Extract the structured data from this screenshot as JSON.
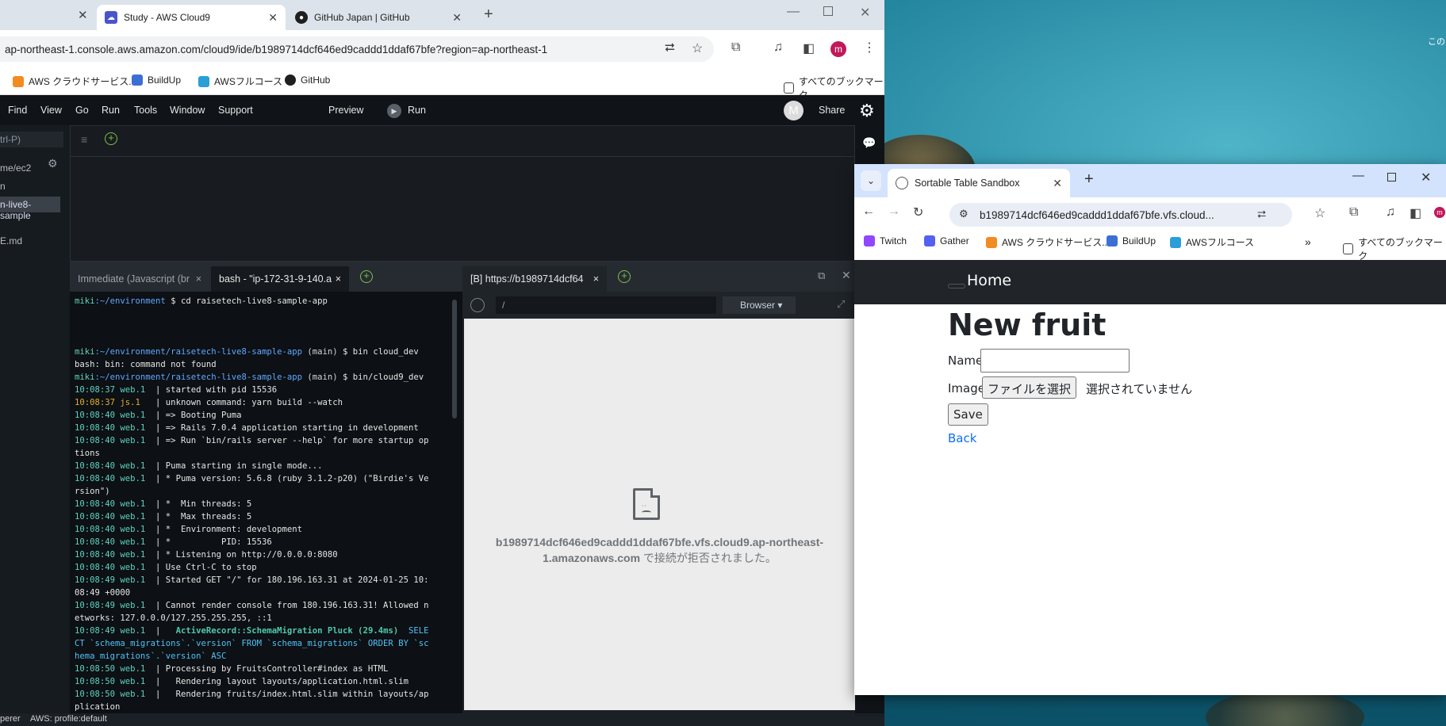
{
  "window1": {
    "tabs": [
      {
        "label": "Study - AWS Cloud9"
      },
      {
        "label": "GitHub Japan | GitHub"
      }
    ],
    "url": "ap-northeast-1.console.aws.amazon.com/cloud9/ide/b1989714dcf646ed9caddd1ddaf67bfe?region=ap-northeast-1",
    "bookmarks": [
      {
        "label": "AWS クラウドサービス..."
      },
      {
        "label": "BuildUp"
      },
      {
        "label": "AWSフルコース"
      },
      {
        "label": "GitHub"
      }
    ],
    "all_bookmarks": "すべてのブックマーク",
    "profile_letter": "m"
  },
  "cloud9": {
    "menu": [
      "Find",
      "View",
      "Go",
      "Run",
      "Tools",
      "Window",
      "Support"
    ],
    "preview": "Preview",
    "run": "Run",
    "avatar": "M",
    "share": "Share",
    "sidebar": {
      "goto": "trl-P)",
      "items": [
        "me/ec2",
        "n",
        "n-live8-sample",
        "E.md"
      ]
    },
    "terminal_tabs": [
      {
        "label": "Immediate (Javascript (br"
      },
      {
        "label": "bash - \"ip-172-31-9-140.a"
      }
    ],
    "terminal_lines": [
      {
        "prefix": "miki",
        "path": ":~/environment",
        "branch": "",
        "cmd": " $ cd raisetech-live8-sample-app"
      },
      {
        "blank": ""
      },
      {
        "blank": ""
      },
      {
        "blank": ""
      },
      {
        "prefix": "miki",
        "path": ":~/environment/raisetech-live8-sample-app",
        "branch": " (main)",
        "cmd": " $ bin cloud_dev"
      },
      {
        "plain": "bash: bin: command not found"
      },
      {
        "prefix": "miki",
        "path": ":~/environment/raisetech-live8-sample-app",
        "branch": " (main)",
        "cmd": " $ bin/cloud9_dev"
      },
      {
        "time": "10:08:37 web.1",
        "text": "  | started with pid 15536"
      },
      {
        "time_y": "10:08:37 js.1 ",
        "text": "  | unknown command: yarn build --watch"
      },
      {
        "time": "10:08:40 web.1",
        "text": "  | => Booting Puma"
      },
      {
        "time": "10:08:40 web.1",
        "text": "  | => Rails 7.0.4 application starting in development"
      },
      {
        "time": "10:08:40 web.1",
        "text": "  | => Run `bin/rails server --help` for more startup op"
      },
      {
        "plain": "tions"
      },
      {
        "time": "10:08:40 web.1",
        "text": "  | Puma starting in single mode..."
      },
      {
        "time": "10:08:40 web.1",
        "text": "  | * Puma version: 5.6.8 (ruby 3.1.2-p20) (\"Birdie's Ve"
      },
      {
        "plain": "rsion\")"
      },
      {
        "time": "10:08:40 web.1",
        "text": "  | *  Min threads: 5"
      },
      {
        "time": "10:08:40 web.1",
        "text": "  | *  Max threads: 5"
      },
      {
        "time": "10:08:40 web.1",
        "text": "  | *  Environment: development"
      },
      {
        "time": "10:08:40 web.1",
        "text": "  | *          PID: 15536"
      },
      {
        "time": "10:08:40 web.1",
        "text": "  | * Listening on http://0.0.0.0:8080"
      },
      {
        "time": "10:08:40 web.1",
        "text": "  | Use Ctrl-C to stop"
      },
      {
        "time": "10:08:49 web.1",
        "text": "  | Started GET \"/\" for 180.196.163.31 at 2024-01-25 10:"
      },
      {
        "plain": "08:49 +0000"
      },
      {
        "time": "10:08:49 web.1",
        "text": "  | Cannot render console from 180.196.163.31! Allowed n"
      },
      {
        "plain": "etworks: 127.0.0.0/127.255.255.255, ::1"
      },
      {
        "time": "10:08:49 web.1",
        "text": "  |   ",
        "hl": "ActiveRecord::SchemaMigration Pluck (29.4ms)",
        "sql": "  SELE"
      },
      {
        "sql_line": "CT `schema_migrations`.`version` FROM `schema_migrations` ORDER BY `sc"
      },
      {
        "sql_line": "hema_migrations`.`version` ASC"
      },
      {
        "time": "10:08:50 web.1",
        "text": "  | Processing by FruitsController#index as HTML"
      },
      {
        "time": "10:08:50 web.1",
        "text": "  |   Rendering layout layouts/application.html.slim"
      },
      {
        "time": "10:08:50 web.1",
        "text": "  |   Rendering fruits/index.html.slim within layouts/ap"
      },
      {
        "plain": "plication"
      }
    ],
    "preview_tab": "[B] https://b1989714dcf64",
    "preview_path": "/",
    "browser_button": "Browser",
    "error_host": "b1989714dcf646ed9caddd1ddaf67bfe.vfs.cloud9.ap-northeast-1.amazonaws.com",
    "error_host_line1": "b1989714dcf646ed9caddd1ddaf67bfe.vfs.cloud9.ap-northeast-",
    "error_host_line2": "1.amazonaws.com",
    "error_suffix": " で接続が拒否されました。",
    "status_left": "perer",
    "status_profile": "AWS: profile:default"
  },
  "desktop_text": "この",
  "window2": {
    "tab": "Sortable Table Sandbox",
    "url": "b1989714dcf646ed9caddd1ddaf67bfe.vfs.cloud...",
    "profile_letter": "m",
    "bookmarks": [
      {
        "label": "Twitch"
      },
      {
        "label": "Gather"
      },
      {
        "label": "AWS クラウドサービス..."
      },
      {
        "label": "BuildUp"
      },
      {
        "label": "AWSフルコース"
      }
    ],
    "all_bookmarks": "すべてのブックマーク",
    "nav_home": "Home",
    "page": {
      "heading": "New fruit",
      "name_label": "Name",
      "name_value": "",
      "image_label": "Image",
      "file_button": "ファイルを選択",
      "file_status": "選択されていません",
      "save": "Save",
      "back": "Back"
    }
  },
  "colors": {
    "link": "#0d6efd",
    "navbar": "#212529",
    "c9_bg": "#1b2026"
  }
}
